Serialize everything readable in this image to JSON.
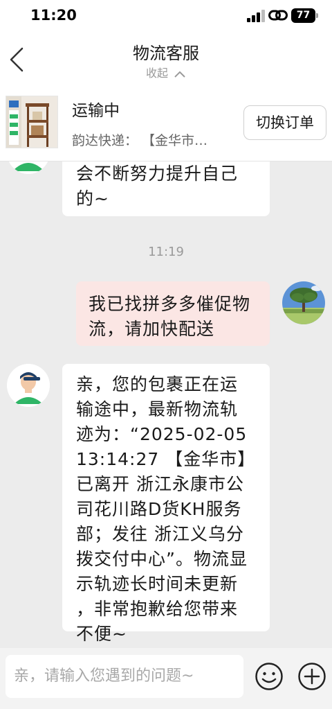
{
  "status_bar": {
    "time": "11:20",
    "battery": "77"
  },
  "nav": {
    "title": "物流客服",
    "collapse_label": "收起"
  },
  "order": {
    "status": "运输中",
    "detail": "韵达快递：  【金华市…",
    "switch_label": "切换订单"
  },
  "chat": {
    "messages": [
      {
        "side": "in",
        "text_lines": [
          "会不断努力提升自己",
          "的~"
        ]
      },
      {
        "side": "time",
        "text": "11:19"
      },
      {
        "side": "out",
        "text_lines": [
          "我已找拼多多催促物",
          "流，请加快配送"
        ]
      },
      {
        "side": "in",
        "text_lines": [
          "亲，您的包裹正在运",
          "输途中，最新物流轨",
          "迹为：“2025-02-05",
          "13:14:27  【金华市】",
          "已离开  浙江永康市公",
          "司花川路D货KH服务",
          "部；发往  浙江义乌分",
          "拨交付中心”。物流显",
          "示轨迹长时间未更新",
          "，非常抱歉给您带来",
          "不便~"
        ]
      }
    ]
  },
  "input": {
    "placeholder": "亲，请输入您遇到的问题~"
  },
  "colors": {
    "out_bubble": "#fbe6e4",
    "agent_green": "#2fb566",
    "background": "#ececec"
  }
}
